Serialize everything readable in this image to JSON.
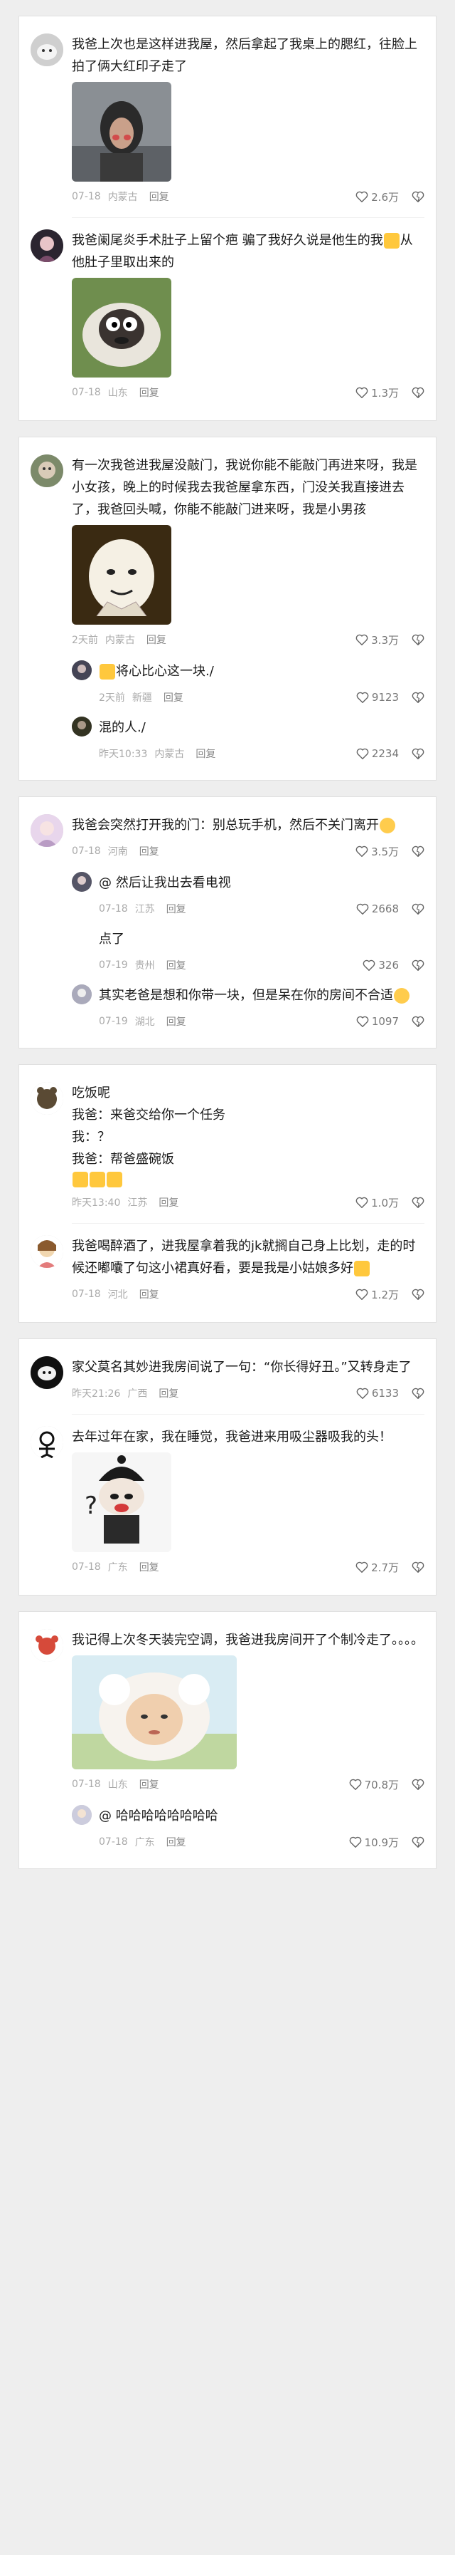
{
  "cards": [
    {
      "comments": [
        {
          "text": "我爸上次也是这样进我屋，然后拿起了我桌上的腮红，往脸上拍了俩大红印子走了",
          "time": "07-18",
          "loc": "内蒙古",
          "reply": "回复",
          "likes": "2.6万"
        },
        {
          "text": "我爸阑尾炎手术肚子上留个疤 骗了我好久说是他生的我",
          "text2": "从他肚子里取出来的",
          "time": "07-18",
          "loc": "山东",
          "reply": "回复",
          "likes": "1.3万"
        }
      ]
    },
    {
      "main": {
        "text": "有一次我爸进我屋没敲门，我说你能不能敲门再进来呀，我是小女孩，晚上的时候我去我爸屋拿东西，门没关我直接进去了，我爸回头喊，你能不能敲门进来呀，我是小男孩",
        "time": "2天前",
        "loc": "内蒙古",
        "reply": "回复",
        "likes": "3.3万"
      },
      "replies": [
        {
          "text": "将心比心这一块./",
          "time": "2天前",
          "loc": "新疆",
          "reply": "回复",
          "likes": "9123"
        },
        {
          "text": "混的人./",
          "time": "昨天10:33",
          "loc": "内蒙古",
          "reply": "回复",
          "likes": "2234"
        }
      ]
    },
    {
      "main": {
        "text": "我爸会突然打开我的门：别总玩手机，然后不关门离开",
        "time": "07-18",
        "loc": "河南",
        "reply": "回复",
        "likes": "3.5万"
      },
      "replies": [
        {
          "text": "@                  然后让我出去看电视",
          "time": "07-18",
          "loc": "江苏",
          "reply": "回复",
          "likes": "2668"
        },
        {
          "text": "点了",
          "time": "07-19",
          "loc": "贵州",
          "reply": "回复",
          "likes": "326"
        },
        {
          "text": "其实老爸是想和你带一块，但是呆在你的房间不合适",
          "time": "07-19",
          "loc": "湖北",
          "reply": "回复",
          "likes": "1097"
        }
      ]
    },
    {
      "comments": [
        {
          "lines": [
            "吃饭呢",
            "我爸：来爸交给你一个任务",
            "我：？",
            "我爸：帮爸盛碗饭"
          ],
          "time": "昨天13:40",
          "loc": "江苏",
          "reply": "回复",
          "likes": "1.0万"
        },
        {
          "text": "我爸喝醉酒了，进我屋拿着我的jk就搁自己身上比划，走的时候还嘟囔了句这小裙真好看，要是我是小姑娘多好",
          "time": "07-18",
          "loc": "河北",
          "reply": "回复",
          "likes": "1.2万"
        }
      ]
    },
    {
      "comments": [
        {
          "text": "家父莫名其妙进我房间说了一句：“你长得好丑。”又转身走了",
          "time": "昨天21:26",
          "loc": "广西",
          "reply": "回复",
          "likes": "6133"
        },
        {
          "text": "去年过年在家，我在睡觉，我爸进来用吸尘器吸我的头！",
          "time": "07-18",
          "loc": "广东",
          "reply": "回复",
          "likes": "2.7万"
        }
      ]
    },
    {
      "main": {
        "text": "我记得上次冬天装完空调，我爸进我房间开了个制冷走了。。。。",
        "time": "07-18",
        "loc": "山东",
        "reply": "回复",
        "likes": "70.8万"
      },
      "replies": [
        {
          "text": "@                  哈哈哈哈哈哈哈哈",
          "time": "07-18",
          "loc": "广东",
          "reply": "回复",
          "likes": "10.9万"
        }
      ]
    }
  ]
}
